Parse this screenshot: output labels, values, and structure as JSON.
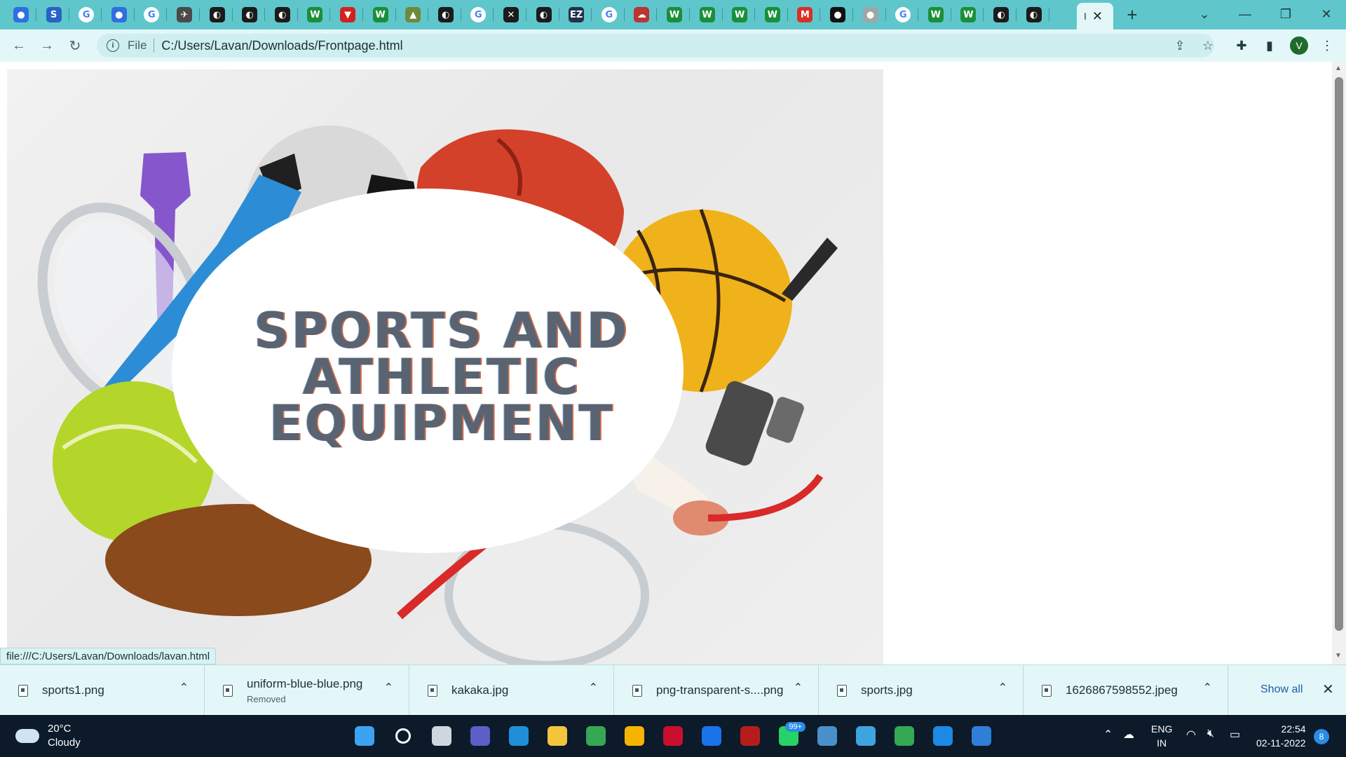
{
  "browser": {
    "tabs": [
      {
        "icon": "person-icon",
        "color": "#2f6fe0",
        "glyph": "●"
      },
      {
        "icon": "s-icon",
        "color": "#2862c7",
        "glyph": "S"
      },
      {
        "icon": "google-icon",
        "color": "#ffffff",
        "glyph": "G"
      },
      {
        "icon": "person-icon",
        "color": "#2f6fe0",
        "glyph": "●"
      },
      {
        "icon": "google-icon",
        "color": "#ffffff",
        "glyph": "G"
      },
      {
        "icon": "bird-icon",
        "color": "#4a4a4a",
        "glyph": "✈"
      },
      {
        "icon": "globe-icon",
        "color": "#1b1b1b",
        "glyph": "◐"
      },
      {
        "icon": "globe-icon",
        "color": "#1b1b1b",
        "glyph": "◐"
      },
      {
        "icon": "globe-icon",
        "color": "#1b1b1b",
        "glyph": "◐"
      },
      {
        "icon": "w-icon",
        "color": "#1a8f3a",
        "glyph": "W"
      },
      {
        "icon": "v-red-icon",
        "color": "#d0231d",
        "glyph": "▼"
      },
      {
        "icon": "w-icon",
        "color": "#1a8f3a",
        "glyph": "W"
      },
      {
        "icon": "image-icon",
        "color": "#6d8a3b",
        "glyph": "▲"
      },
      {
        "icon": "globe-icon",
        "color": "#1b1b1b",
        "glyph": "◐"
      },
      {
        "icon": "google-icon",
        "color": "#ffffff",
        "glyph": "G"
      },
      {
        "icon": "x-icon",
        "color": "#1b1b1b",
        "glyph": "✕"
      },
      {
        "icon": "globe-icon",
        "color": "#1b1b1b",
        "glyph": "◐"
      },
      {
        "icon": "ez-icon",
        "color": "#22324a",
        "glyph": "EZ"
      },
      {
        "icon": "google-icon",
        "color": "#ffffff",
        "glyph": "G"
      },
      {
        "icon": "cloud-red-icon",
        "color": "#b33",
        "glyph": "☁"
      },
      {
        "icon": "w-icon",
        "color": "#1a8f3a",
        "glyph": "W"
      },
      {
        "icon": "w-icon",
        "color": "#1a8f3a",
        "glyph": "W"
      },
      {
        "icon": "w-icon",
        "color": "#1a8f3a",
        "glyph": "W"
      },
      {
        "icon": "w-icon",
        "color": "#1a8f3a",
        "glyph": "W"
      },
      {
        "icon": "gmail-icon",
        "color": "#d93025",
        "glyph": "M"
      },
      {
        "icon": "github-icon",
        "color": "#111",
        "glyph": "●"
      },
      {
        "icon": "gray-circle-icon",
        "color": "#9fa6a8",
        "glyph": "●"
      },
      {
        "icon": "google-icon",
        "color": "#ffffff",
        "glyph": "G"
      },
      {
        "icon": "w-icon",
        "color": "#1a8f3a",
        "glyph": "W"
      },
      {
        "icon": "w-icon",
        "color": "#1a8f3a",
        "glyph": "W"
      },
      {
        "icon": "globe-icon",
        "color": "#1b1b1b",
        "glyph": "◐"
      },
      {
        "icon": "globe-icon",
        "color": "#1b1b1b",
        "glyph": "◐"
      }
    ],
    "active_tab": {
      "favicon": "I",
      "close": "✕"
    },
    "new_tab": "+",
    "address": {
      "scheme": "File",
      "url": "C:/Users/Lavan/Downloads/Frontpage.html"
    },
    "profile_initial": "V"
  },
  "page": {
    "hero_title_lines": [
      "SPORTS AND",
      "ATHLETIC",
      "EQUIPMENT"
    ],
    "status_url": "file:///C:/Users/Lavan/Downloads/lavan.html"
  },
  "downloads": {
    "items": [
      {
        "name": "sports1.png",
        "sub": ""
      },
      {
        "name": "uniform-blue-blue.png",
        "sub": "Removed"
      },
      {
        "name": "kakaka.jpg",
        "sub": ""
      },
      {
        "name": "png-transparent-s....png",
        "sub": ""
      },
      {
        "name": "sports.jpg",
        "sub": ""
      },
      {
        "name": "1626867598552.jpeg",
        "sub": ""
      }
    ],
    "show_all": "Show all"
  },
  "taskbar": {
    "weather": {
      "temp": "20°C",
      "cond": "Cloudy"
    },
    "apps": [
      {
        "icon": "windows-start-icon",
        "color": "#3da2f2"
      },
      {
        "icon": "search-icon",
        "color": "#0c1a2a"
      },
      {
        "icon": "task-view-icon",
        "color": "#cfd6dd"
      },
      {
        "icon": "meet-icon",
        "color": "#5b5fc7"
      },
      {
        "icon": "edge-icon",
        "color": "#1f8fd8"
      },
      {
        "icon": "file-explorer-icon",
        "color": "#f2c53d"
      },
      {
        "icon": "chrome-icon",
        "color": "#34a853"
      },
      {
        "icon": "store-icon",
        "color": "#f4b400"
      },
      {
        "icon": "mcafee-icon",
        "color": "#c8102e"
      },
      {
        "icon": "help-icon",
        "color": "#1a73e8"
      },
      {
        "icon": "app-red-icon",
        "color": "#b71c1c"
      },
      {
        "icon": "whatsapp-icon",
        "color": "#25d366"
      },
      {
        "icon": "bird-app-icon",
        "color": "#4a90c8"
      },
      {
        "icon": "notepad-icon",
        "color": "#3fa3e0"
      },
      {
        "icon": "chrome-profile-icon",
        "color": "#34a853"
      },
      {
        "icon": "vscode-icon",
        "color": "#1e88e5"
      },
      {
        "icon": "photos-icon",
        "color": "#2f7fd6"
      }
    ],
    "whatsapp_badge": "99+",
    "lang": {
      "l1": "ENG",
      "l2": "IN"
    },
    "clock": {
      "time": "22:54",
      "date": "02-11-2022"
    },
    "notifications": "8"
  }
}
